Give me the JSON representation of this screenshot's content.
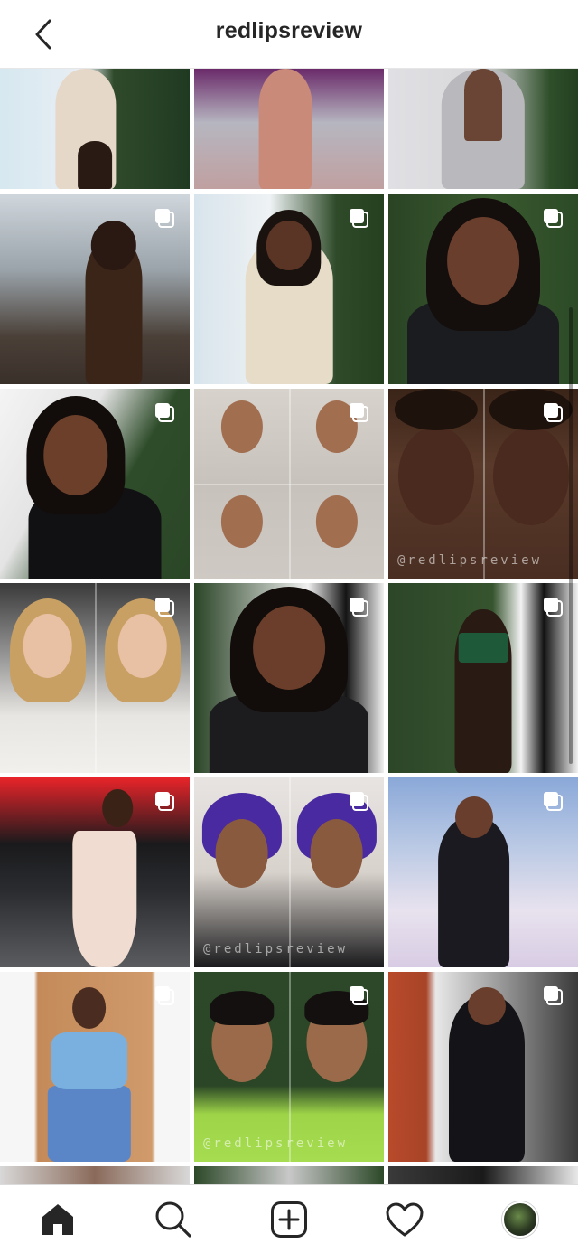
{
  "header": {
    "username": "redlipsreview"
  },
  "icons": {
    "back": "chevron-left-icon",
    "home": "home-icon",
    "search": "search-icon",
    "new_post": "plus-square-icon",
    "activity": "heart-icon",
    "profile": "avatar"
  },
  "colors": {
    "text": "#262626",
    "divider": "#dbdbdb",
    "background": "#ffffff"
  },
  "grid": {
    "watermark_text": "@redlipsreview",
    "watermark_tiles": [
      8,
      14,
      17
    ],
    "multi_tiles": [
      3,
      4,
      5,
      6,
      7,
      8,
      9,
      10,
      11,
      12,
      13,
      14,
      15,
      16,
      17
    ]
  }
}
